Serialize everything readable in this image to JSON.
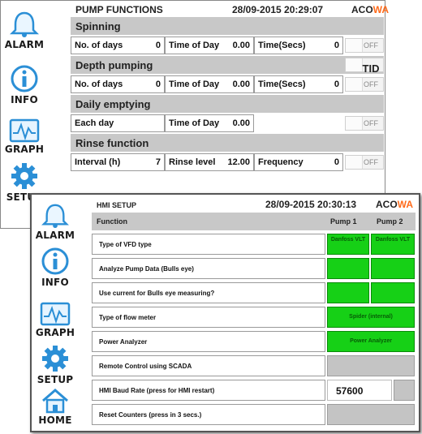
{
  "back_window": {
    "title": "PUMP FUNCTIONS",
    "datetime": "28/09-2015 20:29:07",
    "logo_a": "ACO",
    "logo_b": "WA",
    "nav": [
      {
        "label": "ALARM",
        "icon": "bell-icon"
      },
      {
        "label": "INFO",
        "icon": "info-icon"
      },
      {
        "label": "GRAPH",
        "icon": "graph-icon"
      },
      {
        "label": "SETUP",
        "icon": "gear-icon"
      }
    ],
    "sections": {
      "spinning": {
        "title": "Spinning",
        "row": {
          "days_label": "No. of days",
          "days_value": "0",
          "tod_label": "Time of Day",
          "tod_value": "0.00",
          "secs_label": "Time(Secs)",
          "secs_value": "0",
          "toggle": "OFF"
        }
      },
      "depth": {
        "title": "Depth pumping",
        "toggle_top": "TID",
        "row": {
          "days_label": "No. of days",
          "days_value": "0",
          "tod_label": "Time of Day",
          "tod_value": "0.00",
          "secs_label": "Time(Secs)",
          "secs_value": "0",
          "toggle": "OFF"
        }
      },
      "daily": {
        "title": "Daily emptying",
        "row": {
          "each_label": "Each day",
          "tod_label": "Time of Day",
          "tod_value": "0.00",
          "toggle": "OFF"
        }
      },
      "rinse": {
        "title": "Rinse function",
        "row": {
          "interval_label": "Interval (h)",
          "interval_value": "7",
          "level_label": "Rinse level",
          "level_value": "12.00",
          "freq_label": "Frequency",
          "freq_value": "0",
          "toggle": "OFF"
        }
      }
    }
  },
  "front_window": {
    "title": "HMI SETUP",
    "datetime": "28/09-2015 20:30:13",
    "logo_a": "ACO",
    "logo_b": "WA",
    "nav": [
      {
        "label": "ALARM",
        "icon": "bell-icon"
      },
      {
        "label": "INFO",
        "icon": "info-icon"
      },
      {
        "label": "GRAPH",
        "icon": "graph-icon"
      },
      {
        "label": "SETUP",
        "icon": "gear-icon"
      },
      {
        "label": "HOME",
        "icon": "home-icon"
      }
    ],
    "header": {
      "function": "Function",
      "pump1": "Pump 1",
      "pump2": "Pump 2"
    },
    "rows": [
      {
        "label": "Type of VFD type",
        "p1": "Danfoss VLT",
        "p2": "Danfoss VLT"
      },
      {
        "label": "Analyze Pump Data (Bulls eye)"
      },
      {
        "label": "Use current for Bulls eye measuring?"
      },
      {
        "label": "Type of flow meter",
        "value": "Spider (internal)"
      },
      {
        "label": "Power Analyzer",
        "value": "Power Analyzer"
      },
      {
        "label": "Remote Control using SCADA"
      },
      {
        "label": "HMI Baud Rate (press for HMI restart)",
        "value": "57600"
      },
      {
        "label": "Reset Counters (press in 3 secs.)"
      }
    ]
  },
  "colors": {
    "green": "#16d016",
    "section_grey": "#c8c8c8",
    "logo_orange": "#ff6a1a",
    "icon_blue": "#3aa0e0"
  }
}
